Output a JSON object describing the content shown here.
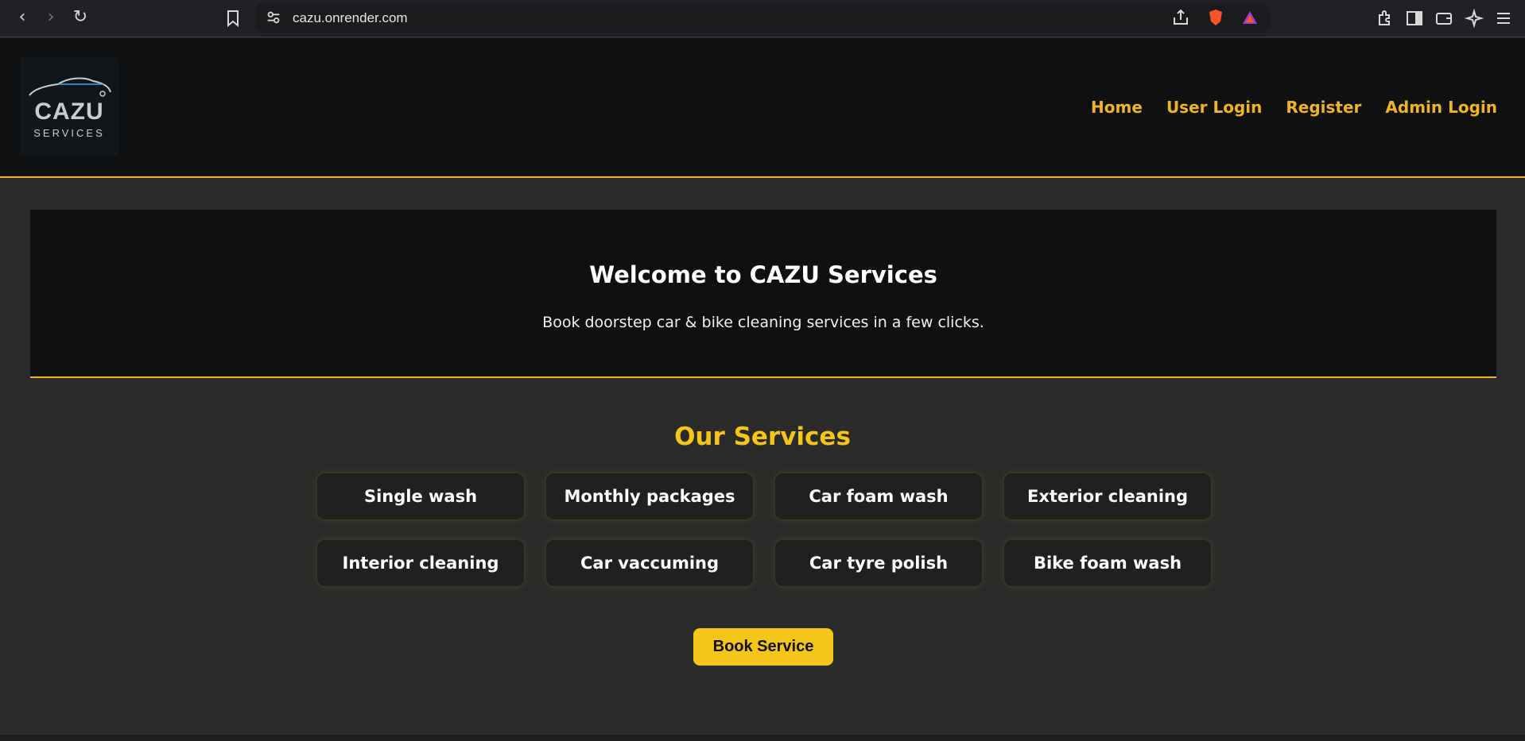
{
  "browser": {
    "url": "cazu.onrender.com"
  },
  "logo": {
    "brand": "CAZU",
    "tagline": "SERVICES"
  },
  "nav": {
    "items": [
      "Home",
      "User Login",
      "Register",
      "Admin Login"
    ]
  },
  "hero": {
    "title": "Welcome to CAZU Services",
    "subtitle": "Book doorstep car & bike cleaning services in a few clicks."
  },
  "services": {
    "title": "Our Services",
    "items": [
      "Single wash",
      "Monthly packages",
      "Car foam wash",
      "Exterior cleaning",
      "Interior cleaning",
      "Car vaccuming",
      "Car tyre polish",
      "Bike foam wash"
    ]
  },
  "cta": {
    "book_label": "Book Service"
  },
  "colors": {
    "accent": "#f0b429",
    "button": "#f5c518",
    "background": "#2b2b2b",
    "panel": "#101010"
  }
}
